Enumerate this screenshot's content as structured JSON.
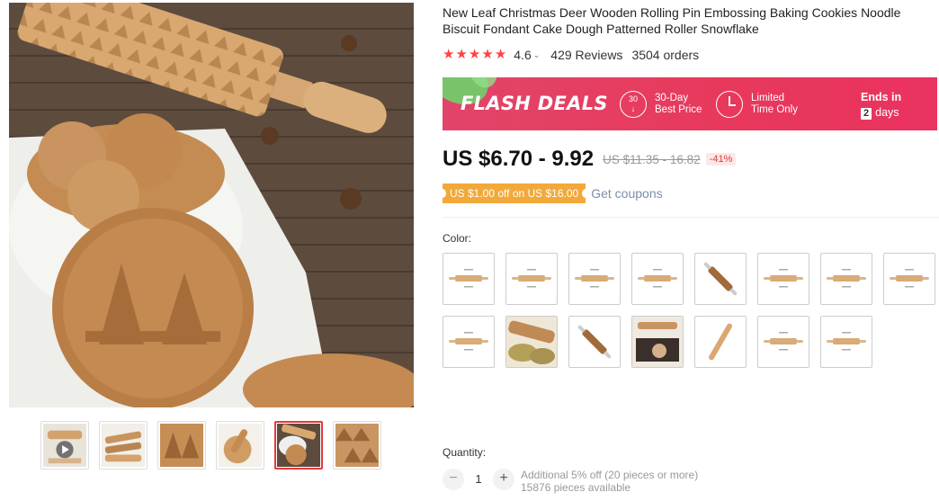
{
  "product": {
    "title": "New Leaf Christmas Deer Wooden Rolling Pin Embossing Baking Cookies Noodle Biscuit Fondant Cake Dough Patterned Roller Snowflake",
    "rating": "4.6",
    "reviews": "429 Reviews",
    "orders": "3504 orders"
  },
  "flash_deal": {
    "title": "FLASH DEALS",
    "icon1_text": "30",
    "badge1_line1": "30-Day",
    "badge1_line2": "Best Price",
    "badge2_line1": "Limited",
    "badge2_line2": "Time Only",
    "ends_label": "Ends in",
    "ends_value": "2",
    "ends_unit": "days",
    "colors": {
      "background": "#e8385b",
      "leaf": "#6ed16a"
    }
  },
  "pricing": {
    "price": "US $6.70 - 9.92",
    "original_price": "US $11.35 - 16.82",
    "discount": "-41%"
  },
  "coupon": {
    "label": "US $1.00 off on US $16.00",
    "link": "Get coupons",
    "color": "#f2a93a"
  },
  "color_selector": {
    "label": "Color:",
    "options": [
      {
        "name": "variant-1",
        "kind": "pin"
      },
      {
        "name": "variant-2",
        "kind": "pin"
      },
      {
        "name": "variant-3",
        "kind": "pin"
      },
      {
        "name": "variant-4",
        "kind": "pin"
      },
      {
        "name": "variant-5",
        "kind": "pin-diagonal"
      },
      {
        "name": "variant-6",
        "kind": "pin"
      },
      {
        "name": "variant-7",
        "kind": "pin"
      },
      {
        "name": "variant-8",
        "kind": "pin"
      },
      {
        "name": "variant-9",
        "kind": "pin"
      },
      {
        "name": "variant-10",
        "kind": "photo-leaves"
      },
      {
        "name": "variant-11",
        "kind": "pin-diagonal"
      },
      {
        "name": "variant-12",
        "kind": "photo-box"
      },
      {
        "name": "variant-13",
        "kind": "plain-pin"
      },
      {
        "name": "variant-14",
        "kind": "pin"
      },
      {
        "name": "variant-15",
        "kind": "pin"
      }
    ]
  },
  "quantity": {
    "label": "Quantity:",
    "value": "1",
    "minus": "−",
    "plus": "+",
    "note_line1": "Additional 5% off (20 pieces or more)",
    "note_line2": "15876 pieces available"
  },
  "gallery": {
    "thumbnails": [
      {
        "name": "thumb-1",
        "kind": "video"
      },
      {
        "name": "thumb-2",
        "kind": "pins"
      },
      {
        "name": "thumb-3",
        "kind": "pin-closeup"
      },
      {
        "name": "thumb-4",
        "kind": "cookie"
      },
      {
        "name": "thumb-5",
        "kind": "main",
        "active": true
      },
      {
        "name": "thumb-6",
        "kind": "pin-pattern"
      }
    ]
  },
  "colors": {
    "accent": "#e4393c",
    "star": "#ff4747"
  }
}
